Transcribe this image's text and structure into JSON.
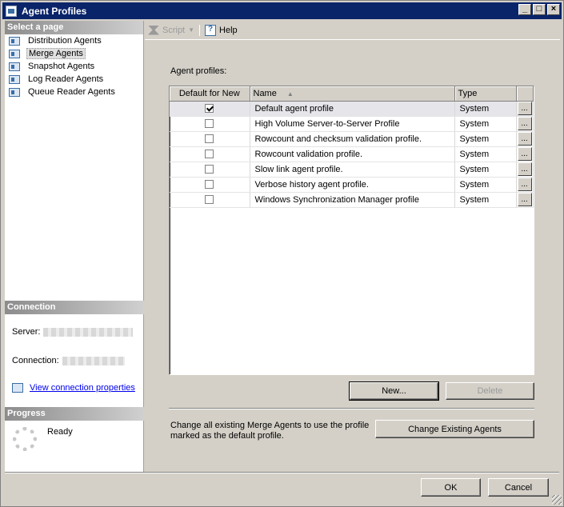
{
  "window": {
    "title": "Agent Profiles"
  },
  "left": {
    "select_page_header": "Select a page",
    "pages": [
      {
        "label": "Distribution Agents",
        "selected": false
      },
      {
        "label": "Merge Agents",
        "selected": true
      },
      {
        "label": "Snapshot Agents",
        "selected": false
      },
      {
        "label": "Log Reader Agents",
        "selected": false
      },
      {
        "label": "Queue Reader Agents",
        "selected": false
      }
    ],
    "connection_header": "Connection",
    "server_label": "Server:",
    "connection_label": "Connection:",
    "view_props_link": "View connection properties",
    "progress_header": "Progress",
    "progress_status": "Ready"
  },
  "toolbar": {
    "script_label": "Script",
    "help_label": "Help"
  },
  "main": {
    "profiles_label": "Agent profiles:",
    "columns": [
      "Default for New",
      "Name",
      "Type"
    ],
    "rows": [
      {
        "default": true,
        "name": "Default agent profile",
        "type": "System"
      },
      {
        "default": false,
        "name": "High Volume Server-to-Server Profile",
        "type": "System"
      },
      {
        "default": false,
        "name": "Rowcount and checksum validation profile.",
        "type": "System"
      },
      {
        "default": false,
        "name": "Rowcount validation profile.",
        "type": "System"
      },
      {
        "default": false,
        "name": "Slow link agent profile.",
        "type": "System"
      },
      {
        "default": false,
        "name": "Verbose history agent profile.",
        "type": "System"
      },
      {
        "default": false,
        "name": "Windows Synchronization Manager profile",
        "type": "System"
      }
    ],
    "ellipsis": "...",
    "new_button": "New...",
    "delete_button": "Delete",
    "change_text": "Change all existing Merge Agents to use the profile marked as the default profile.",
    "change_button": "Change Existing Agents"
  },
  "footer": {
    "ok": "OK",
    "cancel": "Cancel"
  }
}
